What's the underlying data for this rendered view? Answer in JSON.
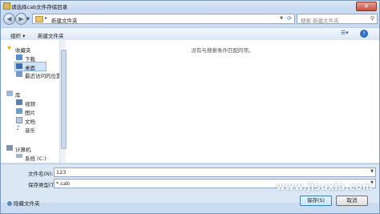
{
  "window": {
    "title": "请选择cab文件存储目录"
  },
  "address": {
    "path": "新建文件夹",
    "search_placeholder": "搜索 新建文件夹"
  },
  "toolbar": {
    "organize": "组织 ▾",
    "new_folder": "新建文件夹"
  },
  "nav": {
    "favorites": "收藏夹",
    "downloads": "下载",
    "desktop": "桌面",
    "recent": "最近访问的位置",
    "libraries": "库",
    "videos": "视频",
    "pictures": "图片",
    "documents": "文档",
    "music": "音乐",
    "computer": "计算机",
    "system": "系统 (C:)"
  },
  "content": {
    "empty_message": "没有与搜索条件匹配的项。"
  },
  "form": {
    "filename_label": "文件名(N):",
    "filename_value": "123",
    "filetype_label": "保存类型(T):",
    "filetype_value": "*.cab"
  },
  "footer": {
    "hide_folders": "隐藏文件夹",
    "save": "保存(S)",
    "cancel": "取消"
  },
  "watermark": "www.jisuxia.com"
}
